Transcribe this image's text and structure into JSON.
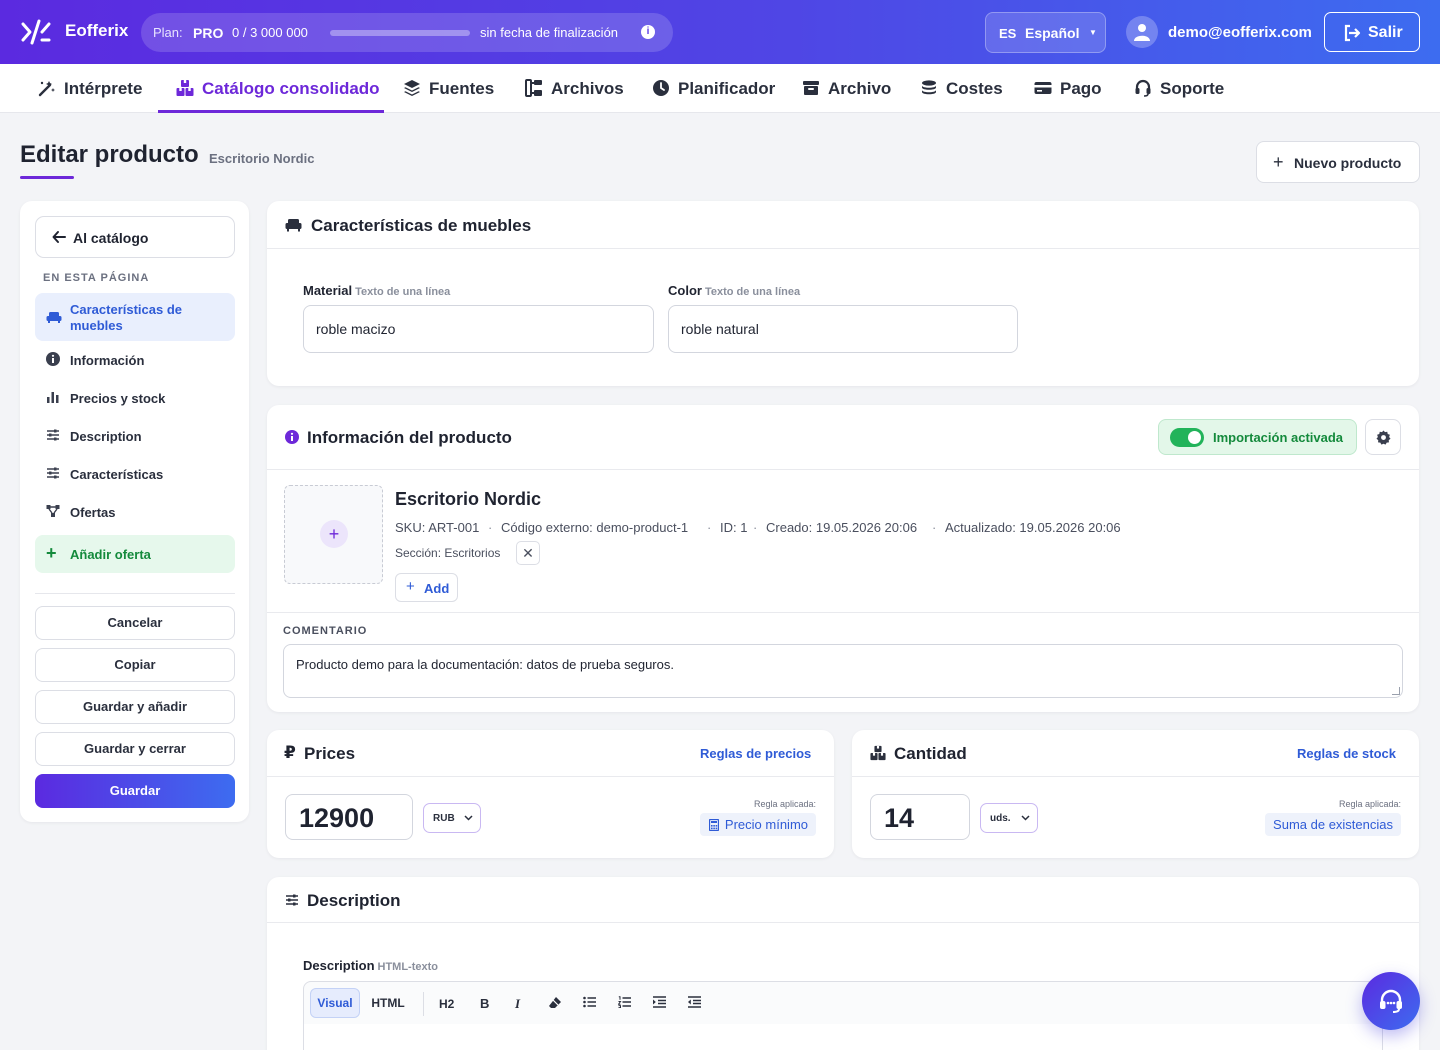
{
  "app": {
    "brand": "Eofferix"
  },
  "plan": {
    "label": "Plan:",
    "name": "PRO",
    "usage": "0 / 3 000 000",
    "usage_fraction": 0.0,
    "end": "sin fecha de finalización"
  },
  "lang": {
    "code": "ES",
    "name": "Español"
  },
  "user": {
    "email": "demo@eofferix.com",
    "logout": "Salir"
  },
  "nav": [
    {
      "label": "Intérprete",
      "icon": "magic-wand-icon"
    },
    {
      "label": "Catálogo consolidado",
      "icon": "boxes-icon",
      "active": true
    },
    {
      "label": "Fuentes",
      "icon": "layers-icon"
    },
    {
      "label": "Archivos",
      "icon": "folder-tree-icon"
    },
    {
      "label": "Planificador",
      "icon": "clock-icon"
    },
    {
      "label": "Archivo",
      "icon": "archive-icon"
    },
    {
      "label": "Costes",
      "icon": "coins-icon"
    },
    {
      "label": "Pago",
      "icon": "credit-card-icon"
    },
    {
      "label": "Soporte",
      "icon": "headset-icon"
    }
  ],
  "page": {
    "title": "Editar producto",
    "subtitle": "Escritorio Nordic",
    "new_product": "Nuevo producto"
  },
  "sidebar": {
    "back": "Al catálogo",
    "heading": "EN ESTA PÁGINA",
    "items": [
      {
        "label": "Características de muebles",
        "icon": "sofa-icon",
        "active": true
      },
      {
        "label": "Información",
        "icon": "info-icon"
      },
      {
        "label": "Precios y stock",
        "icon": "bar-chart-icon"
      },
      {
        "label": "Description",
        "icon": "sliders-icon"
      },
      {
        "label": "Características",
        "icon": "sliders-icon"
      },
      {
        "label": "Ofertas",
        "icon": "network-icon"
      }
    ],
    "add_offer": "Añadir oferta",
    "buttons": {
      "cancel": "Cancelar",
      "copy": "Copiar",
      "save_add": "Guardar y añadir",
      "save_close": "Guardar y cerrar",
      "save": "Guardar"
    }
  },
  "furniture": {
    "title": "Características de muebles",
    "material": {
      "label": "Material",
      "hint": "Texto de una línea",
      "value": "roble macizo"
    },
    "color": {
      "label": "Color",
      "hint": "Texto de una línea",
      "value": "roble natural"
    }
  },
  "info": {
    "title": "Información del producto",
    "import_toggle": "Importación activada",
    "import_enabled": true,
    "product_name": "Escritorio Nordic",
    "sku": "SKU: ART-001",
    "external_code": "Código externo: demo-product-1",
    "id": "ID: 1",
    "created": "Creado: 19.05.2026 20:06",
    "updated": "Actualizado: 19.05.2026 20:06",
    "section": "Sección: Escritorios",
    "add": "Add",
    "comment_label": "COMENTARIO",
    "comment": "Producto demo para la documentación: datos de prueba seguros."
  },
  "prices": {
    "title": "Prices",
    "rules_link": "Reglas de precios",
    "value": "12900",
    "currency": "RUB",
    "applied_label": "Regla aplicada:",
    "applied_rule": "Precio mínimo"
  },
  "quantity": {
    "title": "Cantidad",
    "rules_link": "Reglas de stock",
    "value": "14",
    "unit": "uds.",
    "applied_label": "Regla aplicada:",
    "applied_rule": "Suma de existencias"
  },
  "description": {
    "title": "Description",
    "field_label": "Description",
    "field_hint": "HTML-texto",
    "tabs": {
      "visual": "Visual",
      "html": "HTML"
    },
    "tools": {
      "h2": "H2",
      "bold": "B",
      "italic": "I"
    }
  },
  "colors": {
    "accent": "#6d28d9",
    "blue": "#2f5bd6",
    "green": "#22b35a",
    "header_start": "#5b2ae0",
    "header_end": "#3d6cf0"
  }
}
